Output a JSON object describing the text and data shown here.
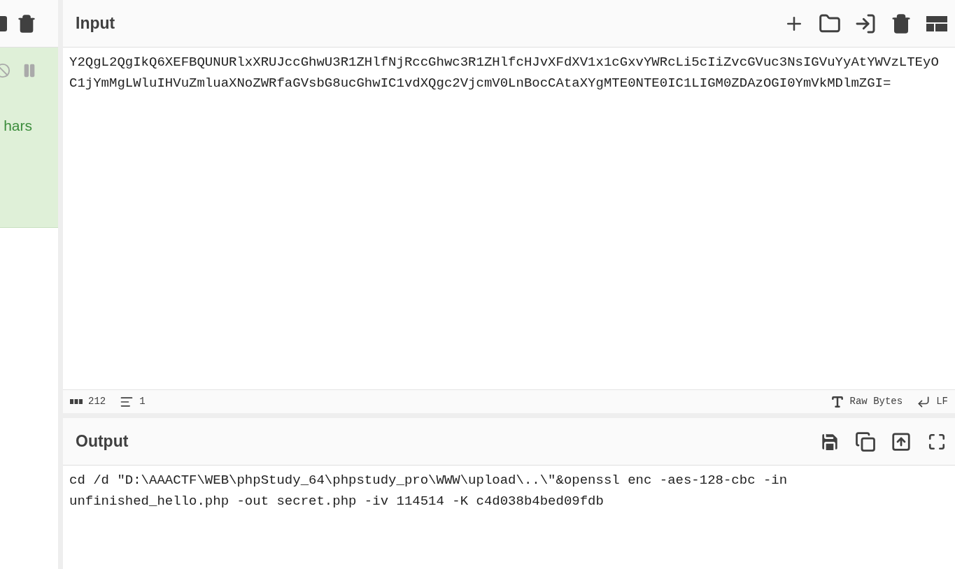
{
  "left_panel": {
    "status_text": "hars"
  },
  "input": {
    "title": "Input",
    "value": "Y2QgL2QgIkQ6XEFBQUNURlxXRUJccGhwU3R1ZHlfNjRccGhwc3R1ZHlfcHJvXFdXV1x1cGxvYWRcLi5cIiZvcGVuc3NsIGVuYyAtYWVzLTEyOC1jYmMgLWluIHVuZmluaXNoZWRfaGVsbG8ucGhwIC1vdXQgc2VjcmV0LnBocCAtaXYgMTE0NTE0IC1LIGM0ZDAzOGI0YmVkMDlmZGI="
  },
  "status_bar": {
    "length": "212",
    "lines": "1",
    "encoding": "Raw Bytes",
    "eol": "LF"
  },
  "output": {
    "title": "Output",
    "value": "cd /d \"D:\\AAACTF\\WEB\\phpStudy_64\\phpstudy_pro\\WWW\\upload\\..\\\"&openssl enc -aes-128-cbc -in unfinished_hello.php -out secret.php -iv 114514 -K c4d038b4bed09fdb"
  }
}
